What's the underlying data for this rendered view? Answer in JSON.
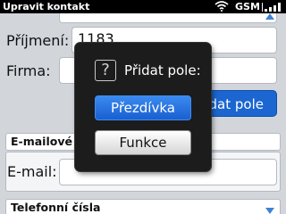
{
  "status_bar": {
    "app_title": "Upravit kontakt",
    "network": "GSM",
    "wifi_icon": "wifi-icon",
    "signal_icon": "signal-bars-icon"
  },
  "form": {
    "surname_label": "Příjmení:",
    "surname_value": "1183",
    "company_label": "Firma:",
    "company_value": "",
    "add_field_button_visible_text": "dat pole",
    "email_section_header": "E-mailové",
    "email_label": "E-mail:",
    "email_value": "",
    "phone_section_header": "Telefonní čísla"
  },
  "dialog": {
    "icon": "question-icon",
    "icon_glyph": "?",
    "title": "Přidat pole:",
    "options": [
      "Přezdívka",
      "Funkce"
    ],
    "selected_option": "Přezdívka"
  },
  "colors": {
    "status_bar_bg": "#000000",
    "accent_blue": "#1b66d0",
    "dialog_bg": "#1c1c1c"
  }
}
